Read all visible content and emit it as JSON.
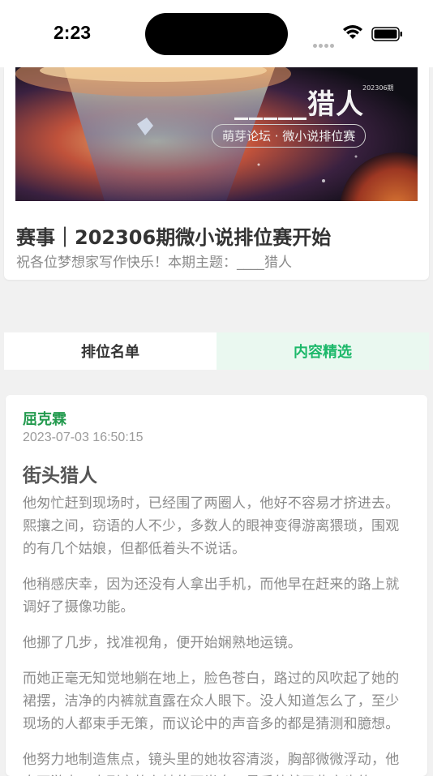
{
  "status_bar": {
    "time": "2:23"
  },
  "event": {
    "banner_title": "_____猎人",
    "banner_badge": "202306期",
    "banner_subtitle": "萌芽论坛 · 微小说排位赛",
    "title": "赛事｜202306期微小说排位赛开始",
    "subtitle": "祝各位梦想家写作快乐！本期主题：____猎人"
  },
  "tabs": {
    "ranking": "排位名单",
    "featured": "内容精选"
  },
  "post": {
    "author": "屈克霖",
    "timestamp": "2023-07-03 16:50:15",
    "title": "街头猎人",
    "paragraphs": [
      "他匆忙赶到现场时，已经围了两圈人，他好不容易才挤进去。熙攘之间，窃语的人不少，多数人的眼神变得游离猥琐，围观的有几个姑娘，但都低着头不说话。",
      "他稍感庆幸，因为还没有人拿出手机，而他早在赶来的路上就调好了摄像功能。",
      "他挪了几步，找准视角，便开始娴熟地运镜。",
      "而她正毫无知觉地躺在地上，脸色苍白，路过的风吹起了她的裙摆，洁净的内裤就直露在众人眼下。没人知道怎么了，至少现场的人都束手无策，而议论中的声音多的都是猜测和臆想。",
      "他努力地制造焦点，镜头里的她妆容清淡，胸部微微浮动，他自下游走，直到定格在她的下半身，最后他就了些意也的"
    ]
  }
}
